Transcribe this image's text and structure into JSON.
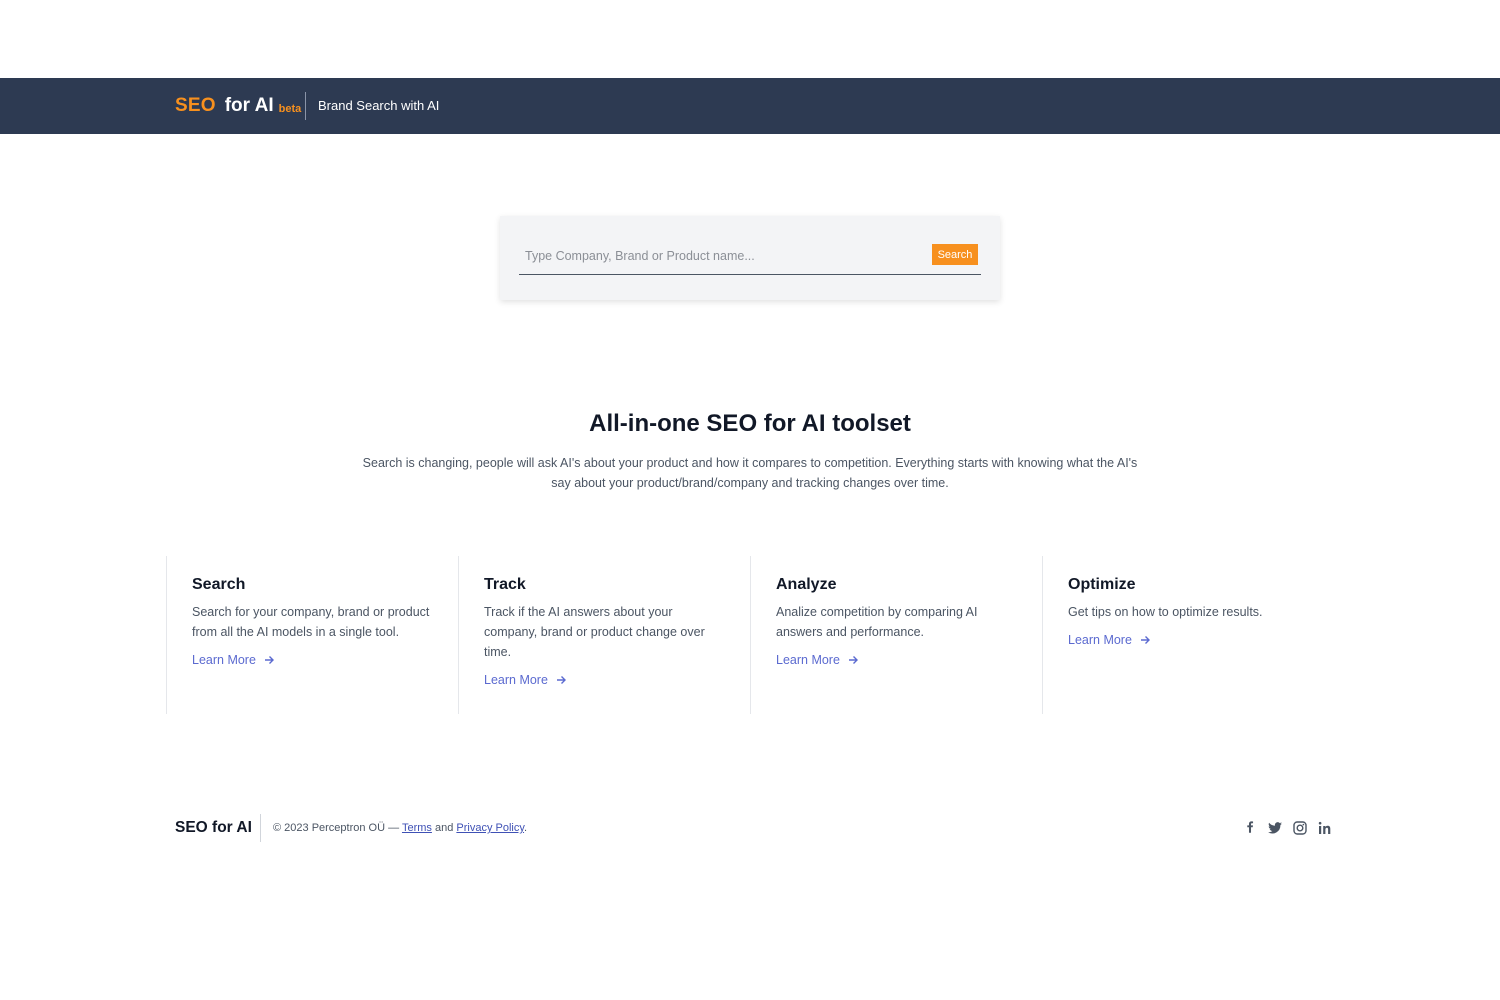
{
  "header": {
    "brand_seo": "SEO",
    "brand_forai": "for AI",
    "brand_beta": "beta",
    "tagline": "Brand Search with AI"
  },
  "search": {
    "placeholder": "Type Company, Brand or Product name...",
    "value": "",
    "button_label": "Search"
  },
  "hero": {
    "title": "All-in-one SEO for AI toolset",
    "description": "Search is changing, people will ask AI's about your product and how it compares to competition. Everything starts with knowing what the AI's say about your product/brand/company and tracking changes over time."
  },
  "features": [
    {
      "title": "Search",
      "description": "Search for your company, brand or product from all the AI models in a single tool.",
      "link": "Learn More"
    },
    {
      "title": "Track",
      "description": "Track if the AI answers about your company, brand or product change over time.",
      "link": "Learn More"
    },
    {
      "title": "Analyze",
      "description": "Analize competition by comparing AI answers and performance.",
      "link": "Learn More"
    },
    {
      "title": "Optimize",
      "description": "Get tips on how to optimize results.",
      "link": "Learn More"
    }
  ],
  "footer": {
    "brand": "SEO for AI",
    "copyright": "© 2023 Perceptron OÜ — ",
    "terms": "Terms",
    "and": " and ",
    "privacy": "Privacy Policy",
    "period": "."
  },
  "social_icons": [
    "facebook-icon",
    "twitter-icon",
    "instagram-icon",
    "linkedin-icon"
  ],
  "colors": {
    "header_bg": "#2d3a52",
    "accent": "#f7901e",
    "link": "#5b6ad0"
  }
}
